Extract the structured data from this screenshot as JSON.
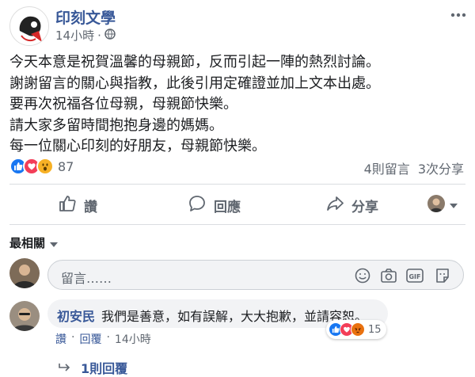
{
  "post": {
    "page_name": "印刻文學",
    "time": "14小時",
    "privacy_icon": "globe-icon",
    "lines": [
      "今天本意是祝賀溫馨的母親節，反而引起一陣的熱烈討論。",
      "謝謝留言的關心與指教，此後引用定確證並加上文本出處。",
      "要再次祝福各位母親，母親節快樂。",
      "請大家多留時間抱抱身邊的媽媽。",
      "每一位關心印刻的好朋友，母親節快樂。"
    ]
  },
  "reactions": {
    "icons": [
      "like-icon",
      "love-icon",
      "wow-icon"
    ],
    "count": "87",
    "comments": "4則留言",
    "shares": "3次分享"
  },
  "actions": {
    "like": "讚",
    "comment": "回應",
    "share": "分享"
  },
  "comments_section": {
    "sort_label": "最相關",
    "input_placeholder": "留言……",
    "input_icons": [
      "emoji-icon",
      "camera-icon",
      "gif-icon",
      "sticker-icon"
    ]
  },
  "comment": {
    "author": "初安民",
    "text": "我們是善意，如有誤解，大大抱歉，並請容恕。",
    "reaction_icons": [
      "like-icon",
      "love-icon",
      "angry-icon"
    ],
    "reaction_count": "15",
    "like": "讚",
    "reply": "回覆",
    "time": "14小時",
    "replies": "1則回覆"
  },
  "colors": {
    "link": "#385898",
    "secondary_text": "#606770",
    "like_blue": "#1877f2",
    "love_red": "#f33e58",
    "wow_yellow": "#f7b125"
  }
}
